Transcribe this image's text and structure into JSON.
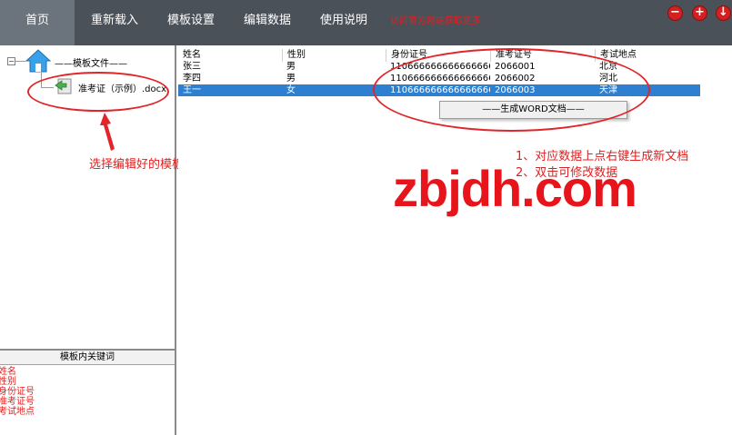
{
  "menu": {
    "items": [
      {
        "label": "首页",
        "active": true
      },
      {
        "label": "重新载入",
        "active": false
      },
      {
        "label": "模板设置",
        "active": false
      },
      {
        "label": "编辑数据",
        "active": false
      },
      {
        "label": "使用说明",
        "active": false
      }
    ],
    "notice": "访问官方网站获取更多"
  },
  "window_controls": {
    "minimize": "−",
    "maximize": "+",
    "close": "↓"
  },
  "tree": {
    "root_label": "——模板文件——",
    "expander": "−",
    "child_label": "准考证（示例）.docx"
  },
  "keywords": {
    "header": "模板内关键词",
    "items": [
      "姓名",
      "性别",
      "身份证号",
      "准考证号",
      "考试地点"
    ]
  },
  "table": {
    "columns": [
      "姓名",
      "性别",
      "身份证号",
      "准考证号",
      "考试地点"
    ],
    "rows": [
      {
        "cells": [
          "张三",
          "男",
          "110666666666666666",
          "2066001",
          "北京"
        ],
        "selected": false
      },
      {
        "cells": [
          "李四",
          "男",
          "110666666666666666",
          "2066002",
          "河北"
        ],
        "selected": false
      },
      {
        "cells": [
          "王一",
          "女",
          "110666666666666666",
          "2066003",
          "天津"
        ],
        "selected": true
      }
    ]
  },
  "context_menu": {
    "item": "——生成WORD文档——"
  },
  "annotations": {
    "select_template": "选择编辑好的模板",
    "step1": "1、对应数据上点右键生成新文档",
    "step2": "2、双击可修改数据"
  },
  "watermark": "zbjdh.com",
  "colors": {
    "menubar_bg": "#4a5159",
    "active_menu_bg": "#6b747c",
    "annotation_red": "#e0262a",
    "selection_blue": "#2e7fd0"
  }
}
